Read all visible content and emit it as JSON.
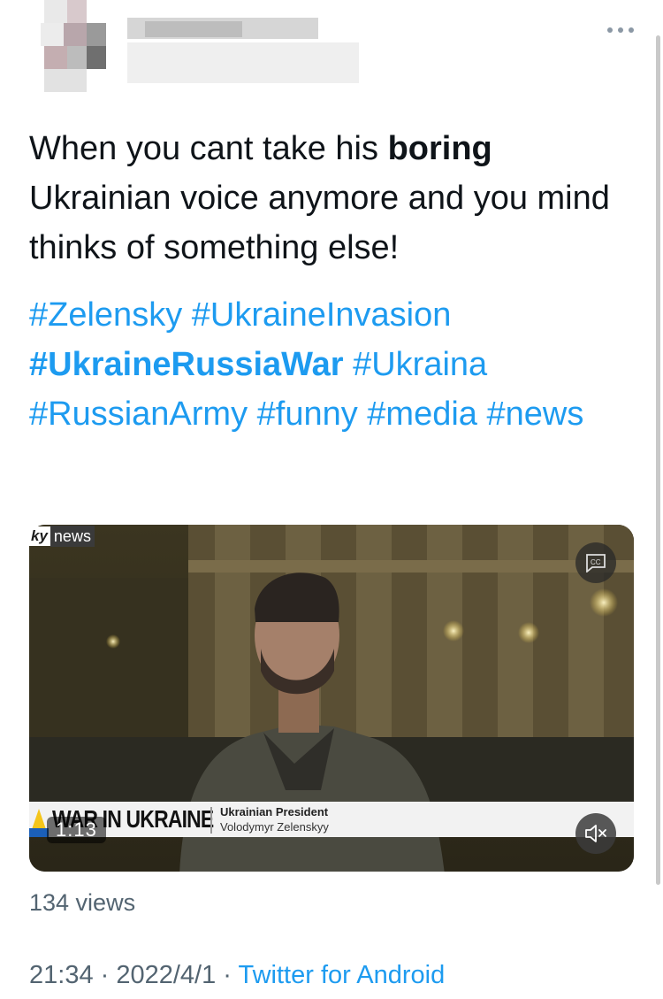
{
  "tweet": {
    "text_before": "When you cant take his ",
    "text_bold": "boring",
    "text_after": " Ukrainian voice anymore and you mind thinks of something else!",
    "hashtags": [
      {
        "text": "#Zelensky",
        "bold": false
      },
      {
        "text": "#UkraineInvasion",
        "bold": false
      },
      {
        "text": "#UkraineRussiaWar",
        "bold": true
      },
      {
        "text": "#Ukraina",
        "bold": false
      },
      {
        "text": "#RussianArmy",
        "bold": false
      },
      {
        "text": "#funny",
        "bold": false
      },
      {
        "text": "#media",
        "bold": false
      },
      {
        "text": "#news",
        "bold": false
      }
    ]
  },
  "video": {
    "channel_logo_left": "ky",
    "channel_logo_right": "news",
    "banner_title": "WAR IN UKRAINE",
    "banner_role": "Ukrainian President",
    "banner_name": "Volodymyr Zelenskyy",
    "duration": "1:13"
  },
  "stats": {
    "views": "134 views"
  },
  "meta": {
    "time": "21:34",
    "separator": " · ",
    "date": "2022/4/1",
    "source": "Twitter for Android"
  },
  "colors": {
    "link": "#1d9bf0",
    "text": "#0f1419",
    "muted": "#536471"
  },
  "icons": [
    "more-icon",
    "closed-captions-icon",
    "mute-icon"
  ]
}
